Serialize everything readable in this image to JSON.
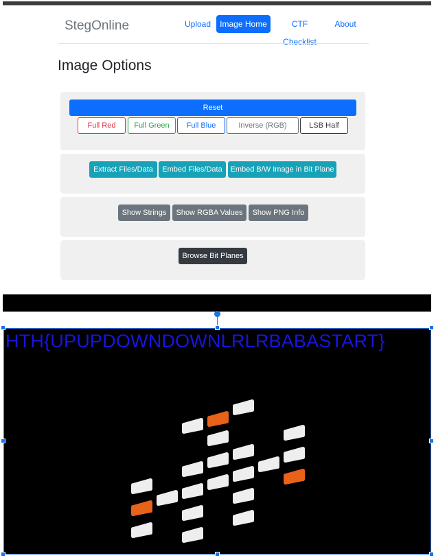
{
  "navbar": {
    "brand": "StegOnline",
    "links": [
      {
        "label": "Upload",
        "active": false
      },
      {
        "label": "Image Home",
        "active": true
      },
      {
        "label": "CTF Checklist",
        "active": false
      },
      {
        "label": "About",
        "active": false
      }
    ]
  },
  "page_title": "Image Options",
  "panel_colour": {
    "reset_label": "Reset",
    "buttons": [
      "Full Red",
      "Full Green",
      "Full Blue",
      "Inverse (RGB)",
      "LSB Half"
    ]
  },
  "panel_files": {
    "buttons": [
      "Extract Files/Data",
      "Embed Files/Data",
      "Embed B/W Image in Bit Plane"
    ]
  },
  "panel_info": {
    "buttons": [
      "Show Strings",
      "Show RGBA Values",
      "Show PNG Info"
    ]
  },
  "panel_planes": {
    "buttons": [
      "Browse Bit Planes"
    ]
  },
  "image": {
    "overlay_text": "HTH{UPUPDOWNDOWNLRLRBABASTART}",
    "tile_colors": {
      "white": "#eeeeee",
      "orange": "#e8621a"
    }
  }
}
